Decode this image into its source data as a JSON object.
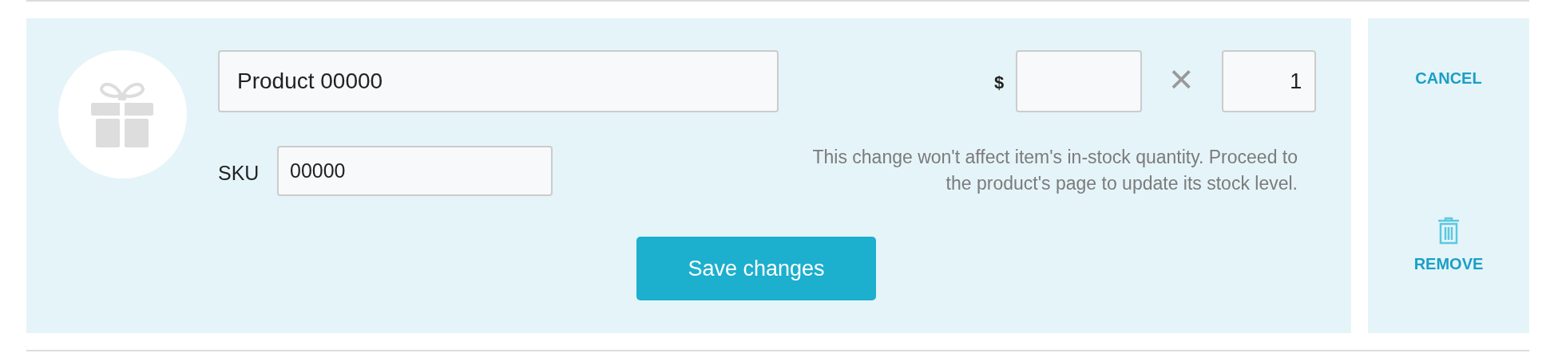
{
  "product_name": {
    "value": "Product 00000"
  },
  "sku": {
    "label": "SKU",
    "value": "00000"
  },
  "price": {
    "currency": "$"
  },
  "multiply_sign": "×",
  "quantity": {
    "value": "1"
  },
  "note": "This change won't affect item's in-stock quantity. Proceed to the product's page to update its stock level.",
  "save_button": "Save changes",
  "cancel_link": "CANCEL",
  "remove_link": "REMOVE"
}
